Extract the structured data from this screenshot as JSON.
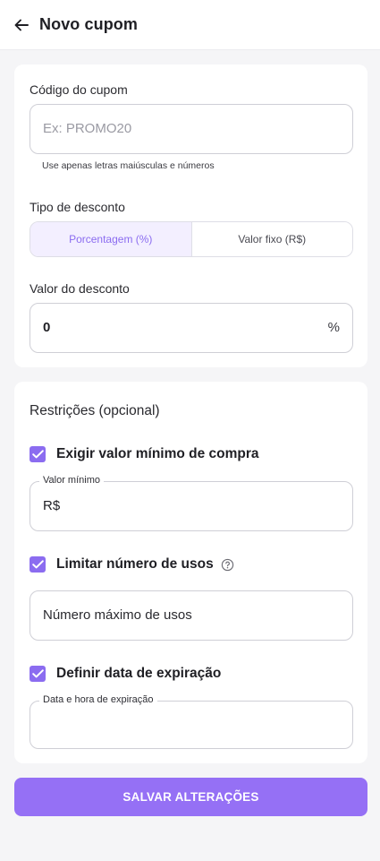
{
  "header": {
    "title": "Novo cupom"
  },
  "coupon_code": {
    "label": "Código do cupom",
    "placeholder": "Ex: PROMO20",
    "hint": "Use apenas letras maiúsculas e números"
  },
  "discount_type": {
    "label": "Tipo de desconto",
    "options": [
      "Porcentagem (%)",
      "Valor fixo (R$)"
    ],
    "selected": "Porcentagem (%)"
  },
  "discount_value": {
    "label": "Valor do desconto",
    "value": "0",
    "suffix": "%"
  },
  "restrictions": {
    "title": "Restrições (opcional)",
    "min_purchase": {
      "label": "Exigir valor mínimo de compra",
      "checked": true,
      "field_label": "Valor mínimo",
      "prefix": "R$"
    },
    "usage_limit": {
      "label": "Limitar número de usos",
      "checked": true,
      "placeholder": "Número máximo de usos"
    },
    "expiration": {
      "label": "Definir data de expiração",
      "checked": true,
      "field_label": "Data e hora de expiração"
    }
  },
  "save_button": {
    "label": "SALVAR ALTERAÇÕES"
  },
  "colors": {
    "accent": "#8b6cf0",
    "button": "#9570f5",
    "background": "#f5f5f7"
  }
}
